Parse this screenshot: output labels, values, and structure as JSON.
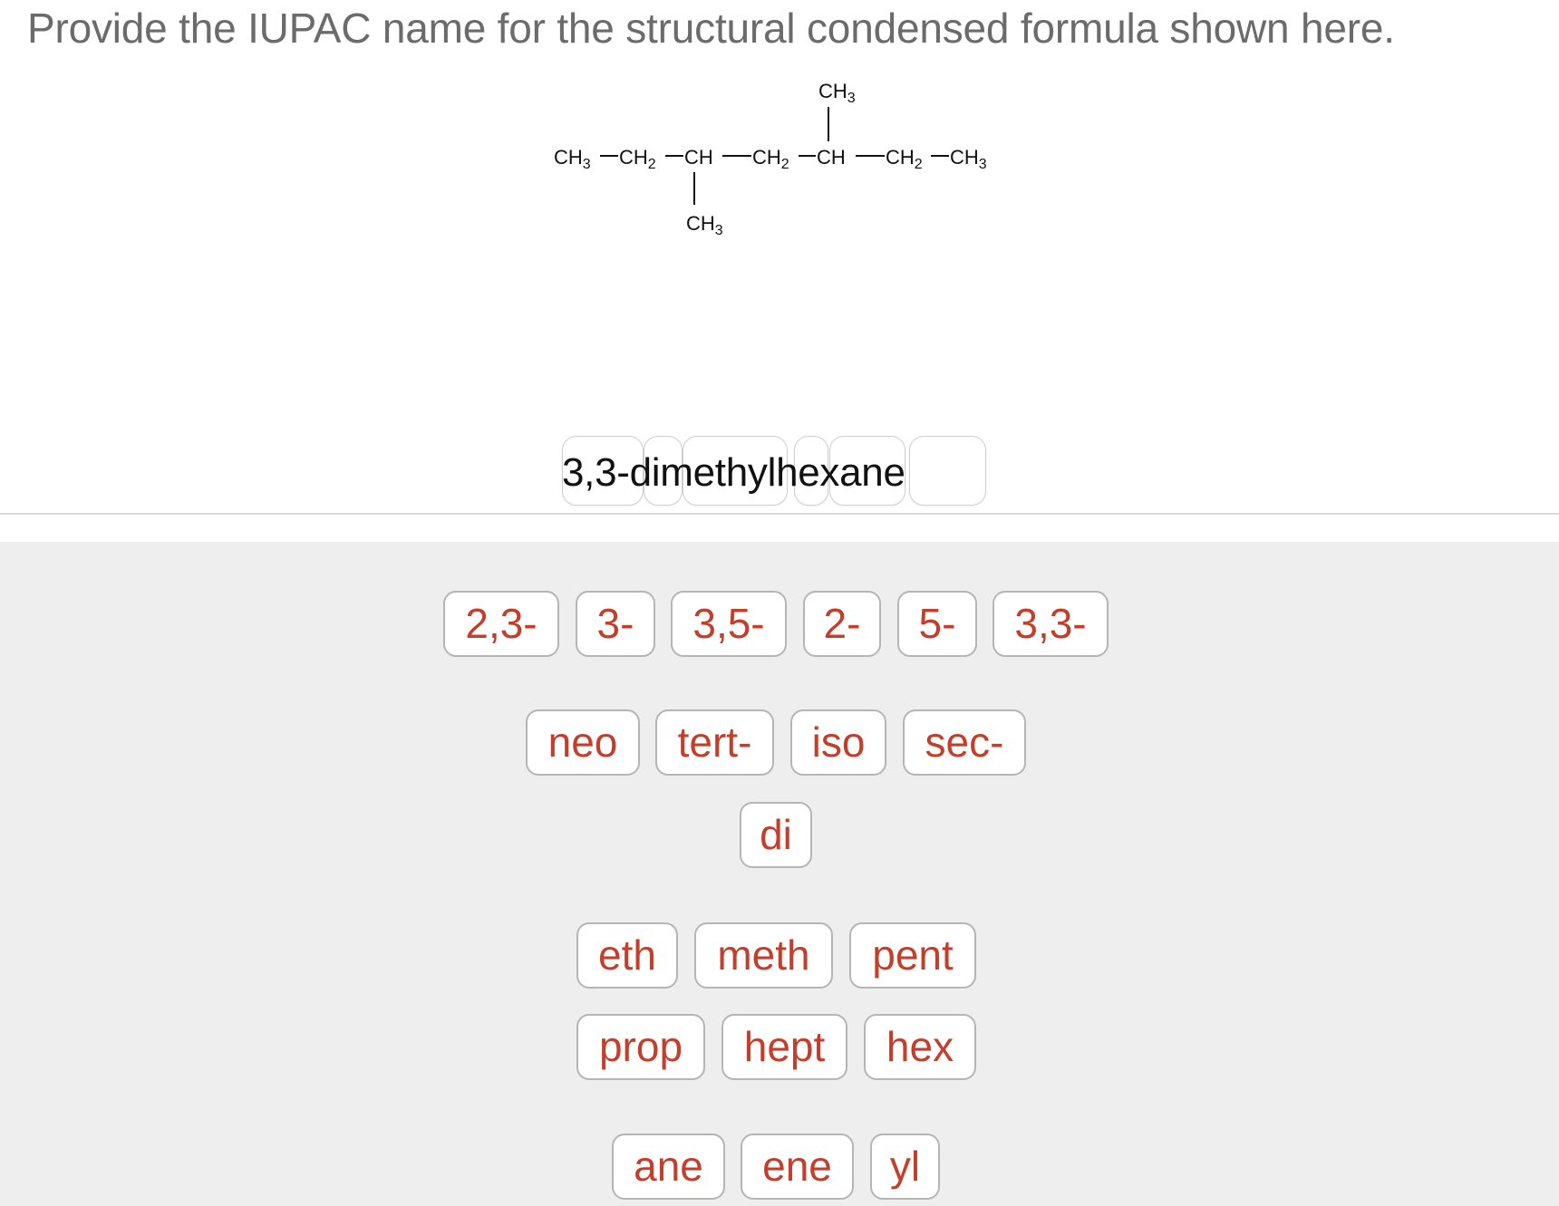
{
  "question": {
    "text": "Provide the IUPAC name for the structural condensed formula shown here."
  },
  "structure": {
    "main_chain": "CH3—CH2—CH—CH2—CH—CH2—CH3",
    "top_substituent": "CH3",
    "bottom_substituent": "CH3"
  },
  "answer": {
    "pieces": [
      "3,3-",
      "di",
      "meth",
      "yl",
      "hex",
      "ane"
    ]
  },
  "bank": {
    "locants": [
      "2,3-",
      "3-",
      "3,5-",
      "2-",
      "5-",
      "3,3-"
    ],
    "prefixes": [
      "neo",
      "tert-",
      "iso",
      "sec-"
    ],
    "multiplier": [
      "di"
    ],
    "roots_row1": [
      "eth",
      "meth",
      "pent"
    ],
    "roots_row2": [
      "prop",
      "hept",
      "hex"
    ],
    "suffixes": [
      "ane",
      "ene",
      "yl"
    ]
  },
  "colors": {
    "tile_text": "#c43e2b",
    "tile_border": "#b5b5b5",
    "bank_background": "#eeeeee",
    "question_text": "#6b6b6b"
  }
}
